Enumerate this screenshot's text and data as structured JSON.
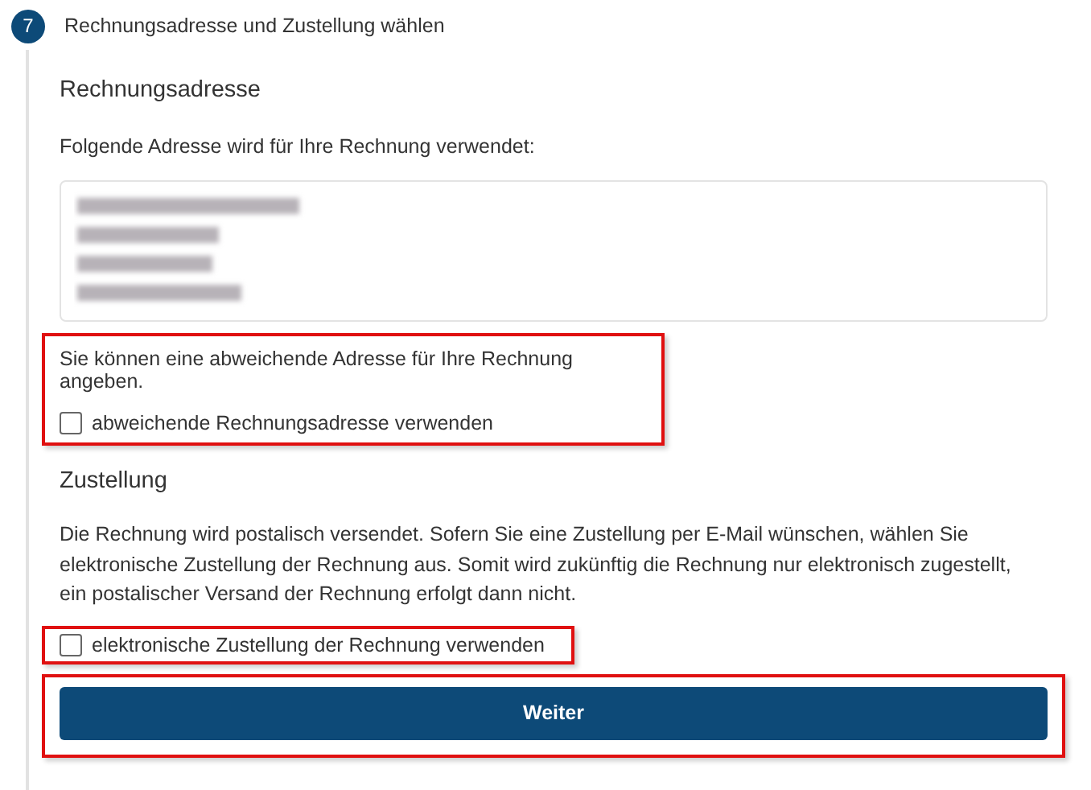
{
  "step": {
    "number": "7",
    "title": "Rechnungsadresse und Zustellung wählen"
  },
  "billing": {
    "heading": "Rechnungsadresse",
    "intro": "Folgende Adresse wird für Ihre Rechnung verwendet:",
    "hint": "Sie können eine abweichende Adresse für Ihre Rechnung angeben.",
    "checkbox": {
      "label": "abweichende Rechnungsadresse verwenden",
      "checked": false
    }
  },
  "delivery": {
    "heading": "Zustellung",
    "text": "Die Rechnung wird postalisch versendet. Sofern Sie eine Zustellung per E-Mail wünschen, wählen Sie elektronische Zustellung der Rechnung aus. Somit wird zukünftig die Rechnung nur elektronisch zugestellt, ein postalischer Versand der Rechnung erfolgt dann nicht.",
    "checkbox": {
      "label": "elektronische Zustellung der Rechnung verwenden",
      "checked": false
    }
  },
  "button": {
    "label": "Weiter"
  }
}
